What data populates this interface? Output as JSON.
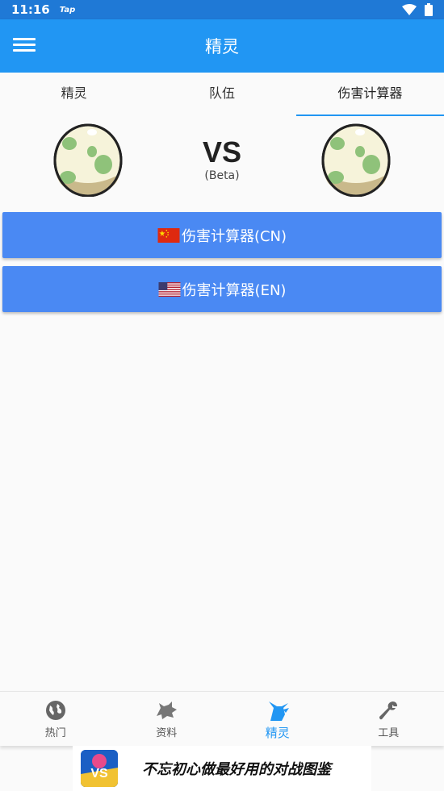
{
  "status": {
    "time": "11:16",
    "app_tag": "Tap"
  },
  "appbar": {
    "title": "精灵"
  },
  "tabs": [
    {
      "label": "精灵"
    },
    {
      "label": "队伍"
    },
    {
      "label": "伤害计算器",
      "active": true
    }
  ],
  "versus": {
    "vs_label": "VS",
    "beta_label": "(Beta)"
  },
  "buttons": {
    "cn_label": "伤害计算器(CN)",
    "en_label": "伤害计算器(EN)"
  },
  "bottom_nav": [
    {
      "label": "热门",
      "icon": "globe-icon"
    },
    {
      "label": "资料",
      "icon": "pokemon-silhouette-icon"
    },
    {
      "label": "精灵",
      "icon": "pikachu-icon",
      "active": true
    },
    {
      "label": "工具",
      "icon": "wrench-icon"
    }
  ],
  "ad": {
    "logo_text": "VS",
    "text": "不忘初心做最好用的对战图鉴"
  },
  "colors": {
    "primary": "#2196f3",
    "status_bar": "#1f79d6",
    "button": "#4a89f3"
  }
}
